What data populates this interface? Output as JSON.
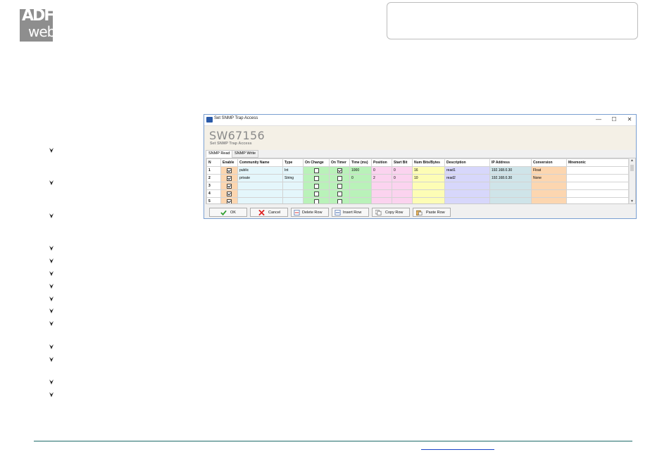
{
  "logo": {
    "line1": "ADF",
    "line2": "web"
  },
  "window": {
    "title": "Set SNMP Trap Access",
    "minimize": "—",
    "maximize": "☐",
    "close": "✕"
  },
  "product": {
    "code": "SW67156",
    "subtitle": "Set SNMP Trap Access"
  },
  "tabs": [
    "SNMP Read",
    "SNMP Write"
  ],
  "columns": [
    "N",
    "Enable",
    "Community Name",
    "Type",
    "On Change",
    "On Timer",
    "Time (ms)",
    "Position",
    "Start Bit",
    "Num Bits/Bytes",
    "Description",
    "IP Address",
    "Conversion",
    "Mnemonic"
  ],
  "rows": [
    {
      "n": "1",
      "enable": true,
      "community": "public",
      "type": "Int",
      "onchange": false,
      "ontimer": true,
      "time": "1000",
      "position": "0",
      "startbit": "0",
      "numbits": "16",
      "description": "read1",
      "ip": "192.168.0.30",
      "conversion": "Float",
      "mnemonic": ""
    },
    {
      "n": "2",
      "enable": true,
      "community": "private",
      "type": "String",
      "onchange": false,
      "ontimer": false,
      "time": "0",
      "position": "2",
      "startbit": "0",
      "numbits": "10",
      "description": "read2",
      "ip": "192.168.0.30",
      "conversion": "None",
      "mnemonic": ""
    },
    {
      "n": "3",
      "enable": true,
      "community": "",
      "type": "",
      "onchange": false,
      "ontimer": false,
      "time": "",
      "position": "",
      "startbit": "",
      "numbits": "",
      "description": "",
      "ip": "",
      "conversion": "",
      "mnemonic": ""
    },
    {
      "n": "4",
      "enable": true,
      "community": "",
      "type": "",
      "onchange": false,
      "ontimer": false,
      "time": "",
      "position": "",
      "startbit": "",
      "numbits": "",
      "description": "",
      "ip": "",
      "conversion": "",
      "mnemonic": ""
    },
    {
      "n": "5",
      "enable": true,
      "community": "",
      "type": "",
      "onchange": false,
      "ontimer": false,
      "time": "",
      "position": "",
      "startbit": "",
      "numbits": "",
      "description": "",
      "ip": "",
      "conversion": "",
      "mnemonic": ""
    }
  ],
  "column_colors": {
    "community": "#e4f6fb",
    "type": "#e4f6fb",
    "onchange": "#b9f2b9",
    "ontimer": "#b9f2b9",
    "time": "#b9f2b9",
    "position": "#fbd3ef",
    "startbit": "#fbd3ef",
    "numbits": "#fdfdb5",
    "description": "#d7d7fb",
    "ip": "#cfe4e9",
    "conversion": "#fcd6b0",
    "mnemonic": "#ffffff",
    "enable": "#fcd6b0"
  },
  "buttons": {
    "ok": "OK",
    "cancel": "Cancel",
    "delete_row": "Delete Row",
    "insert_row": "Insert Row",
    "copy_row": "Copy Row",
    "paste_row": "Paste Row"
  }
}
